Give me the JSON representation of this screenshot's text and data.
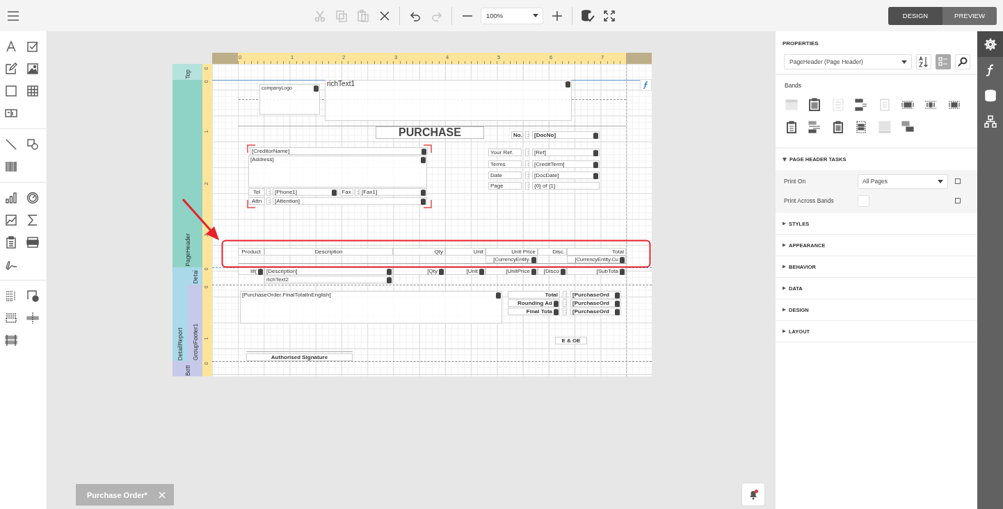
{
  "toolbar": {
    "items": [
      {
        "kind": "cut",
        "disabled": true
      },
      {
        "kind": "copy",
        "disabled": true
      },
      {
        "kind": "paste",
        "disabled": true
      },
      {
        "kind": "delete",
        "disabled": false
      },
      {
        "kind": "separator"
      },
      {
        "kind": "undo",
        "disabled": false
      },
      {
        "kind": "redo",
        "disabled": true
      },
      {
        "kind": "separator"
      },
      {
        "kind": "zoom-out",
        "disabled": false
      },
      {
        "kind": "zoom",
        "value": "100%"
      },
      {
        "kind": "zoom-in",
        "disabled": false
      },
      {
        "kind": "separator"
      },
      {
        "kind": "validate",
        "disabled": false
      },
      {
        "kind": "fullscreen",
        "disabled": false
      }
    ]
  },
  "mode_switch": [
    {
      "label": "DESIGN",
      "selected": true
    },
    {
      "label": "PREVIEW",
      "selected": false
    }
  ],
  "report": {
    "ruler": {
      "horizontal": [
        "0",
        "1",
        "2",
        "3",
        "4",
        "5",
        "6",
        "7"
      ],
      "vertical": [
        "0",
        "0",
        "1",
        "2",
        "3",
        "0",
        "0",
        "1",
        "0"
      ]
    },
    "bands": [
      {
        "label": "Top"
      },
      {
        "label": "PageHeader"
      },
      {
        "label": "DetailReport"
      },
      {
        "label": "Detai"
      },
      {
        "label": "GroupFooter1"
      },
      {
        "label": "Bott"
      }
    ],
    "controls": [
      {
        "text": "companyLogo",
        "kind": "bound"
      },
      {
        "text": "richText1",
        "kind": "bound"
      },
      {
        "text": "PURCHASE",
        "kind": "title"
      },
      {
        "text": "No.",
        "kind": "bold"
      },
      {
        "text": ":",
        "kind": "text"
      },
      {
        "text": "[DocNo]",
        "kind": "bound-bold"
      },
      {
        "text": "[CreditorName]",
        "kind": "bound"
      },
      {
        "text": "[Address]",
        "kind": "bound"
      },
      {
        "text": "Tel",
        "kind": "text"
      },
      {
        "text": ":",
        "kind": "text"
      },
      {
        "text": "[Phone1]",
        "kind": "bound"
      },
      {
        "text": "Fax",
        "kind": "text"
      },
      {
        "text": ":",
        "kind": "text"
      },
      {
        "text": "[Fax1]",
        "kind": "bound"
      },
      {
        "text": "Attn",
        "kind": "text"
      },
      {
        "text": ":",
        "kind": "text"
      },
      {
        "text": "[Attention]",
        "kind": "bound"
      },
      {
        "text": "Your Ref.",
        "kind": "text"
      },
      {
        "text": ":",
        "kind": "text"
      },
      {
        "text": "[Ref]",
        "kind": "bound"
      },
      {
        "text": "Terms",
        "kind": "text"
      },
      {
        "text": ":",
        "kind": "text"
      },
      {
        "text": "[CreditTerm]",
        "kind": "bound"
      },
      {
        "text": "Date",
        "kind": "text"
      },
      {
        "text": ":",
        "kind": "text"
      },
      {
        "text": "[DocDate]",
        "kind": "bound"
      },
      {
        "text": "Page",
        "kind": "text"
      },
      {
        "text": ":",
        "kind": "text"
      },
      {
        "text": "{0} of {1}",
        "kind": "text"
      },
      {
        "text": "Product",
        "kind": "text"
      },
      {
        "text": "Description",
        "kind": "text"
      },
      {
        "text": "Qty",
        "kind": "text"
      },
      {
        "text": "Unit",
        "kind": "text"
      },
      {
        "text": "Unit Price",
        "kind": "text"
      },
      {
        "text": "Disc.",
        "kind": "text"
      },
      {
        "text": "Total",
        "kind": "text"
      },
      {
        "text": "[CurrencyEntity.",
        "kind": "bound"
      },
      {
        "text": "[CurrencyEntity.Cu",
        "kind": "bound"
      },
      {
        "text": "Iif(",
        "kind": "bound"
      },
      {
        "text": "[Description]",
        "kind": "bound"
      },
      {
        "text": "[Qty",
        "kind": "bound"
      },
      {
        "text": "[Unit",
        "kind": "bound"
      },
      {
        "text": "[UnitPrice",
        "kind": "bound"
      },
      {
        "text": "[Disco",
        "kind": "bound"
      },
      {
        "text": "[SubTota",
        "kind": "bound"
      },
      {
        "text": "richText2",
        "kind": "bound"
      },
      {
        "text": "[PurchaseOrder.FinalTotalInEnglish]",
        "kind": "bound"
      },
      {
        "text": "Total",
        "kind": "bold"
      },
      {
        "text": ":",
        "kind": "text"
      },
      {
        "text": "[PurchaseOrd",
        "kind": "bound-bold"
      },
      {
        "text": "Rounding Ad",
        "kind": "bound-bold"
      },
      {
        "text": ":",
        "kind": "text"
      },
      {
        "text": "[PurchaseOrd",
        "kind": "bound-bold"
      },
      {
        "text": "Final Tota",
        "kind": "bound-bold"
      },
      {
        "text": ":",
        "kind": "text"
      },
      {
        "text": "[PurchaseOrd",
        "kind": "bound-bold"
      },
      {
        "text": "E & OE",
        "kind": "bold"
      },
      {
        "text": "Authorised Signature",
        "kind": "bold"
      }
    ]
  },
  "properties": {
    "title": "PROPERTIES",
    "selector": "PageHeader (Page Header)",
    "tools": [
      {
        "kind": "sort",
        "selected": false
      },
      {
        "kind": "categories",
        "selected": true
      },
      {
        "kind": "search",
        "selected": false
      }
    ],
    "bands_label": "Bands",
    "band_icons": [
      {
        "disabled": true
      },
      {
        "disabled": false
      },
      {
        "disabled": true
      },
      {
        "disabled": false
      },
      {
        "disabled": true
      },
      {
        "disabled": false
      },
      {
        "disabled": false
      },
      {
        "disabled": false
      },
      {
        "disabled": false
      },
      {
        "disabled": false
      },
      {
        "disabled": false
      },
      {
        "disabled": false
      },
      {
        "disabled": true
      },
      {
        "disabled": false
      }
    ],
    "tasks": {
      "title": "PAGE HEADER TASKS",
      "expanded": true,
      "rows": [
        {
          "label": "Print On",
          "kind": "select",
          "value": "All Pages"
        },
        {
          "label": "Print Across Bands",
          "kind": "checkbox",
          "checked": false
        }
      ]
    },
    "sections": [
      {
        "title": "STYLES",
        "expanded": false
      },
      {
        "title": "APPEARANCE",
        "expanded": false
      },
      {
        "title": "BEHAVIOR",
        "expanded": false
      },
      {
        "title": "DATA",
        "expanded": false
      },
      {
        "title": "DESIGN",
        "expanded": false
      },
      {
        "title": "LAYOUT",
        "expanded": false
      }
    ]
  },
  "side_tabs": [
    {
      "kind": "settings",
      "selected": true
    },
    {
      "kind": "function",
      "selected": false
    },
    {
      "kind": "database",
      "selected": false
    },
    {
      "kind": "hierarchy",
      "selected": false
    }
  ],
  "document_tab": {
    "title": "Purchase Order*",
    "selected": true
  }
}
